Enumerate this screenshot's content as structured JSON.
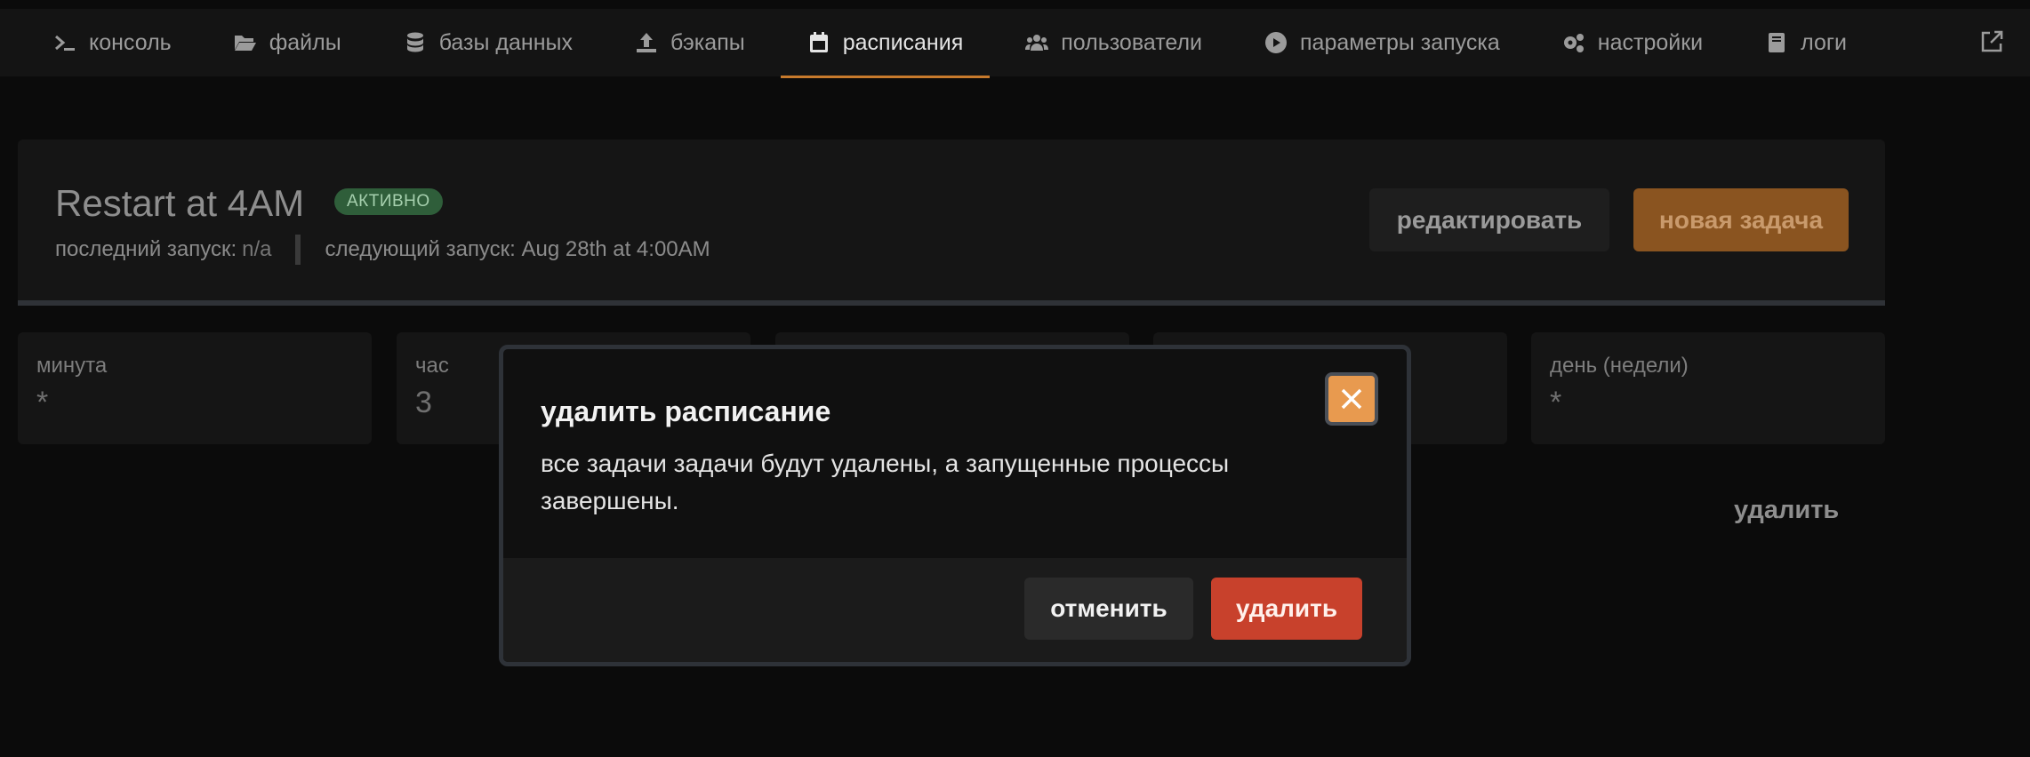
{
  "nav": {
    "items": [
      {
        "label": "консоль",
        "icon": "terminal-icon"
      },
      {
        "label": "файлы",
        "icon": "folder-open-icon"
      },
      {
        "label": "базы данных",
        "icon": "database-icon"
      },
      {
        "label": "бэкапы",
        "icon": "upload-icon"
      },
      {
        "label": "расписания",
        "icon": "calendar-icon",
        "active": true
      },
      {
        "label": "пользователи",
        "icon": "users-icon"
      },
      {
        "label": "параметры запуска",
        "icon": "play-circle-icon"
      },
      {
        "label": "настройки",
        "icon": "cogs-icon"
      },
      {
        "label": "логи",
        "icon": "book-icon"
      }
    ],
    "external_icon": "external-link-icon",
    "accent": "#c77a2c"
  },
  "schedule": {
    "title": "Restart at 4AM",
    "status": "АКТИВНО",
    "last_run_label": "последний запуск:",
    "last_run_value": "n/a",
    "next_run": "следующий запуск: Aug 28th at 4:00AM",
    "edit_label": "редактировать",
    "new_task_label": "новая задача"
  },
  "cron": [
    {
      "label": "минута",
      "value": "*"
    },
    {
      "label": "час",
      "value": "3"
    },
    {
      "label": "",
      "value": ""
    },
    {
      "label": "",
      "value": ""
    },
    {
      "label": "день (недели)",
      "value": "*"
    }
  ],
  "delete_label": "удалить",
  "modal": {
    "title": "удалить расписание",
    "body": "все задачи задачи будут удалены, а запущенные процессы завершены.",
    "cancel_label": "отменить",
    "confirm_label": "удалить",
    "confirm_color": "#c8412c"
  }
}
